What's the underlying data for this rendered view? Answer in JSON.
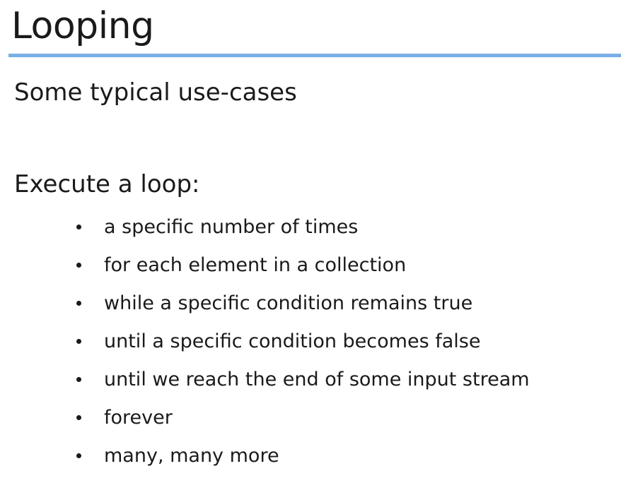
{
  "slide": {
    "title": "Looping",
    "subtitle": "Some typical use-cases",
    "section_heading": "Execute a loop:",
    "bullets": [
      "a specific number of times",
      "for each element in a collection",
      "while a specific condition remains true",
      "until a specific condition becomes false",
      "until we reach the end of some input stream",
      "forever",
      "many, many more"
    ],
    "colors": {
      "title_rule": "#79aee6",
      "text": "#1a1a1a",
      "background": "#ffffff"
    }
  }
}
